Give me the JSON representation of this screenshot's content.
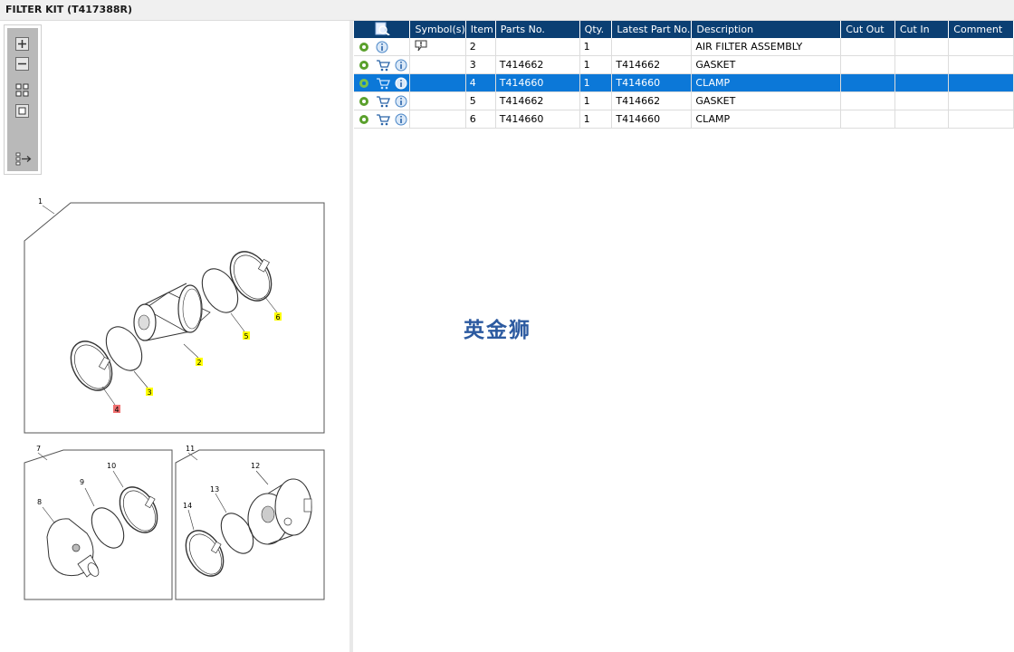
{
  "window": {
    "title": "FILTER KIT (T417388R)"
  },
  "toolbar": {
    "zoom_in_icon": "plus-magnifier-icon",
    "zoom_out_icon": "minus-magnifier-icon",
    "fit_icon": "fit-grid-icon",
    "actual_size_icon": "square-icon",
    "export_icon": "list-arrow-icon"
  },
  "grid": {
    "columns": [
      "",
      "Symbol(s)",
      "Item",
      "Parts No.",
      "Qty.",
      "Latest Part No.",
      "Description",
      "Cut Out",
      "Cut In",
      "Comment"
    ],
    "rows": [
      {
        "icons": [
          "gear-icon",
          "info-icon"
        ],
        "symbol": "comment-icon",
        "item": "2",
        "parts_no": "",
        "qty": "1",
        "latest": "",
        "description": "AIR FILTER ASSEMBLY",
        "cut_out": "",
        "cut_in": "",
        "comment": "",
        "selected": false
      },
      {
        "icons": [
          "gear-icon",
          "cart-icon",
          "info-icon"
        ],
        "symbol": "",
        "item": "3",
        "parts_no": "T414662",
        "qty": "1",
        "latest": "T414662",
        "description": "GASKET",
        "cut_out": "",
        "cut_in": "",
        "comment": "",
        "selected": false
      },
      {
        "icons": [
          "gear-icon",
          "cart-icon",
          "info-icon"
        ],
        "symbol": "",
        "item": "4",
        "parts_no": "T414660",
        "qty": "1",
        "latest": "T414660",
        "description": "CLAMP",
        "cut_out": "",
        "cut_in": "",
        "comment": "",
        "selected": true
      },
      {
        "icons": [
          "gear-icon",
          "cart-icon",
          "info-icon"
        ],
        "symbol": "",
        "item": "5",
        "parts_no": "T414662",
        "qty": "1",
        "latest": "T414662",
        "description": "GASKET",
        "cut_out": "",
        "cut_in": "",
        "comment": "",
        "selected": false
      },
      {
        "icons": [
          "gear-icon",
          "cart-icon",
          "info-icon"
        ],
        "symbol": "",
        "item": "6",
        "parts_no": "T414660",
        "qty": "1",
        "latest": "T414660",
        "description": "CLAMP",
        "cut_out": "",
        "cut_in": "",
        "comment": "",
        "selected": false
      }
    ]
  },
  "drawing": {
    "callouts": [
      "1",
      "2",
      "3",
      "4",
      "5",
      "6",
      "7",
      "8",
      "9",
      "10",
      "11",
      "12",
      "13",
      "14"
    ],
    "highlighted_callout": "4"
  },
  "watermark": "英金狮",
  "colors": {
    "header": "#0b3f73",
    "selected_row": "#0c78d8",
    "callout_yellow": "#ffff00",
    "callout_red": "#f07070"
  }
}
